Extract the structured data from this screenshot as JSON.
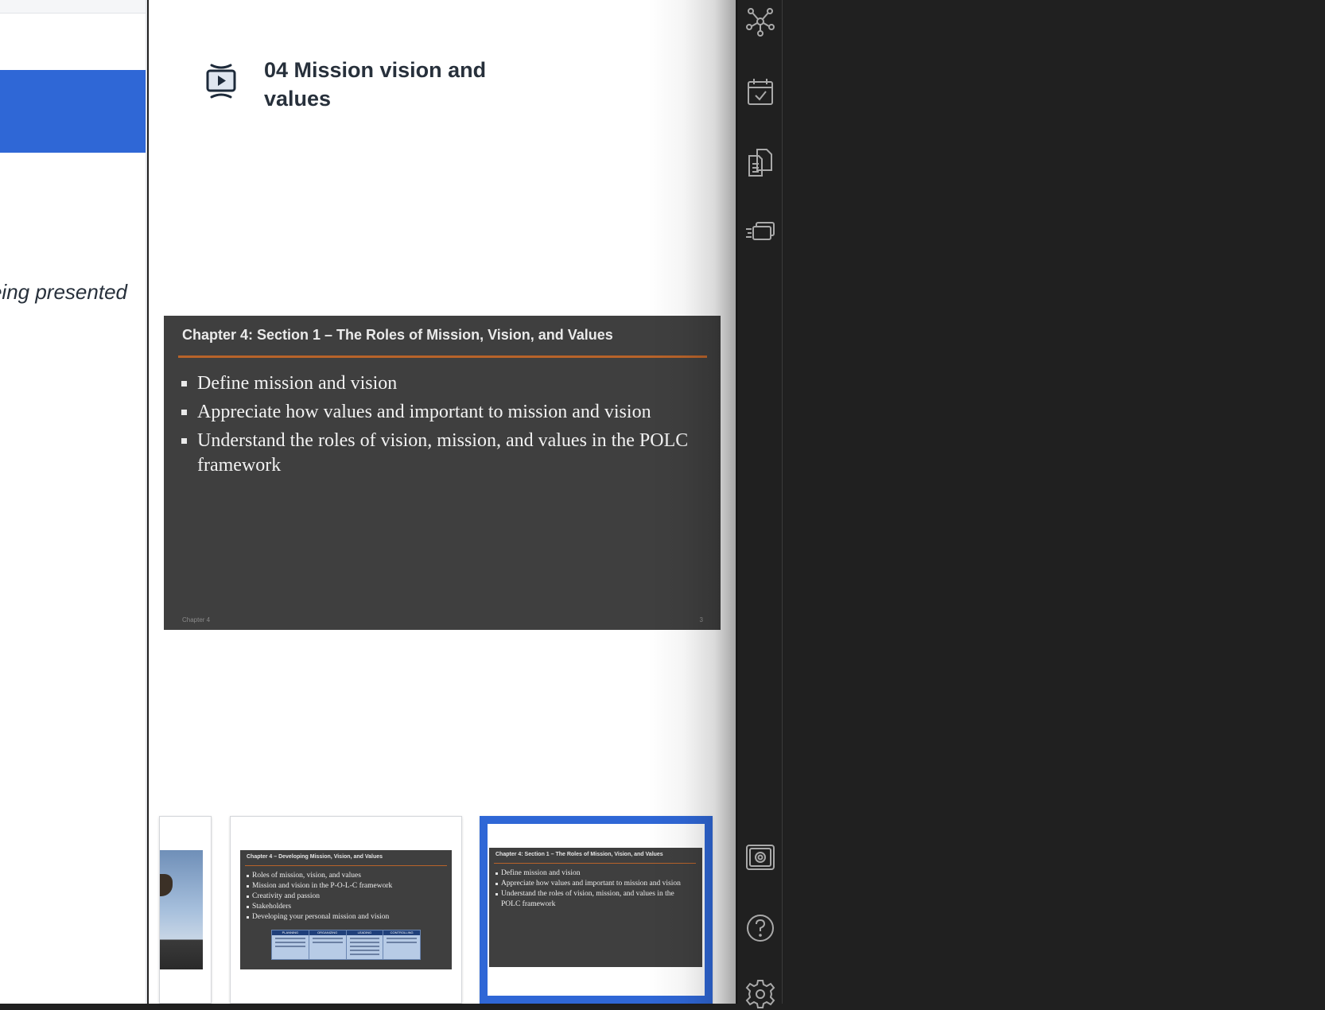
{
  "left_panel": {
    "presenting_text": "eing presented"
  },
  "lesson": {
    "title": "04 Mission vision and values",
    "icon": "video-player-icon"
  },
  "main_slide": {
    "title": "Chapter 4: Section 1 – The Roles of Mission, Vision, and Values",
    "bullets": [
      "Define mission and vision",
      "Appreciate how values and important to mission and vision",
      "Understand the roles of vision, mission, and values in the POLC framework"
    ],
    "footer": "Chapter 4",
    "page_number": "3"
  },
  "thumbnails": {
    "thumb_2": {
      "title": "Chapter 4 – Developing Mission, Vision, and Values",
      "bullets": [
        "Roles of mission, vision, and values",
        "Mission and vision in the P-O-L-C framework",
        "Creativity and passion",
        "Stakeholders",
        "Developing your personal mission and vision"
      ],
      "table_headers": [
        "PLANNING",
        "ORGANIZING",
        "LEADING",
        "CONTROLLING"
      ]
    },
    "thumb_3": {
      "title": "Chapter 4: Section 1 – The Roles of Mission, Vision, and Values",
      "bullets": [
        "Define mission and vision",
        "Appreciate how values and important to mission and vision",
        "Understand the roles of vision, mission, and values in the POLC framework"
      ]
    }
  },
  "rail": {
    "icons": [
      "network-icon",
      "calendar-check-icon",
      "documents-icon",
      "flashcards-icon",
      "screenshot-icon",
      "help-icon",
      "settings-icon"
    ]
  },
  "colors": {
    "accent_blue": "#2f67d6",
    "slide_bg": "#3f3f3f",
    "slide_rule": "#b8632a",
    "rail_bg": "#202020"
  }
}
